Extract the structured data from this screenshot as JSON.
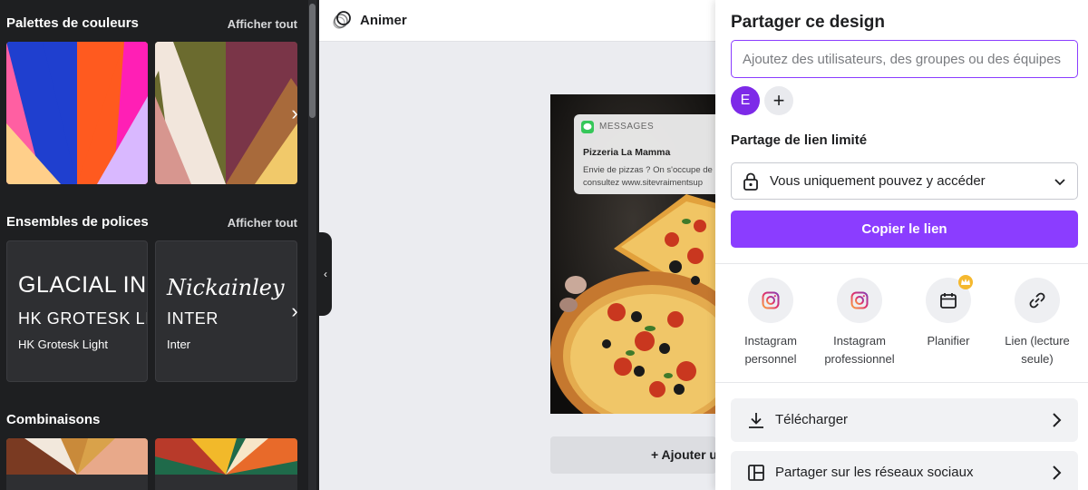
{
  "left_panel": {
    "color_palettes": {
      "title": "Palettes de couleurs",
      "see_all": "Afficher tout"
    },
    "font_sets": {
      "title": "Ensembles de polices",
      "see_all": "Afficher tout",
      "cards": [
        {
          "heading": "GLACIAL INDIFFERENCE",
          "subheading": "HK GROTESK LIGHT",
          "body": "HK Grotesk Light"
        },
        {
          "heading": "Nickainley",
          "subheading": "INTER",
          "body": "Inter"
        }
      ]
    },
    "combinations": {
      "title": "Combinaisons"
    }
  },
  "toolbar": {
    "animate_label": "Animer"
  },
  "design": {
    "notification": {
      "app": "MESSAGES",
      "title": "Pizzeria La Mamma",
      "body_line1": "Envie de pizzas ? On s'occupe de",
      "body_line2": "consultez www.sitevraimentsup"
    }
  },
  "canvas": {
    "add_page_label": "+ Ajouter une page"
  },
  "share_panel": {
    "title": "Partager ce design",
    "people_input_placeholder": "Ajoutez des utilisateurs, des groupes ou des équipes",
    "avatar_initial": "E",
    "add_person_symbol": "+",
    "link_section_label": "Partage de lien limité",
    "access_value": "Vous uniquement pouvez y accéder",
    "copy_link_label": "Copier le lien",
    "options": [
      {
        "label_line1": "Instagram",
        "label_line2": "personnel",
        "icon": "instagram-icon"
      },
      {
        "label_line1": "Instagram",
        "label_line2": "professionnel",
        "icon": "instagram-icon"
      },
      {
        "label_line1": "Planifier",
        "label_line2": "",
        "icon": "calendar-icon"
      },
      {
        "label_line1": "Lien (lecture",
        "label_line2": "seule)",
        "icon": "link-icon"
      }
    ],
    "actions": [
      {
        "label": "Télécharger",
        "icon": "download-icon"
      },
      {
        "label": "Partager sur les réseaux sociaux",
        "icon": "layout-icon"
      }
    ]
  },
  "colors": {
    "accent": "#8b3dff",
    "avatar": "#7d2ae8",
    "panel_dark": "#1e1f21",
    "premium": "#f5b82e"
  }
}
